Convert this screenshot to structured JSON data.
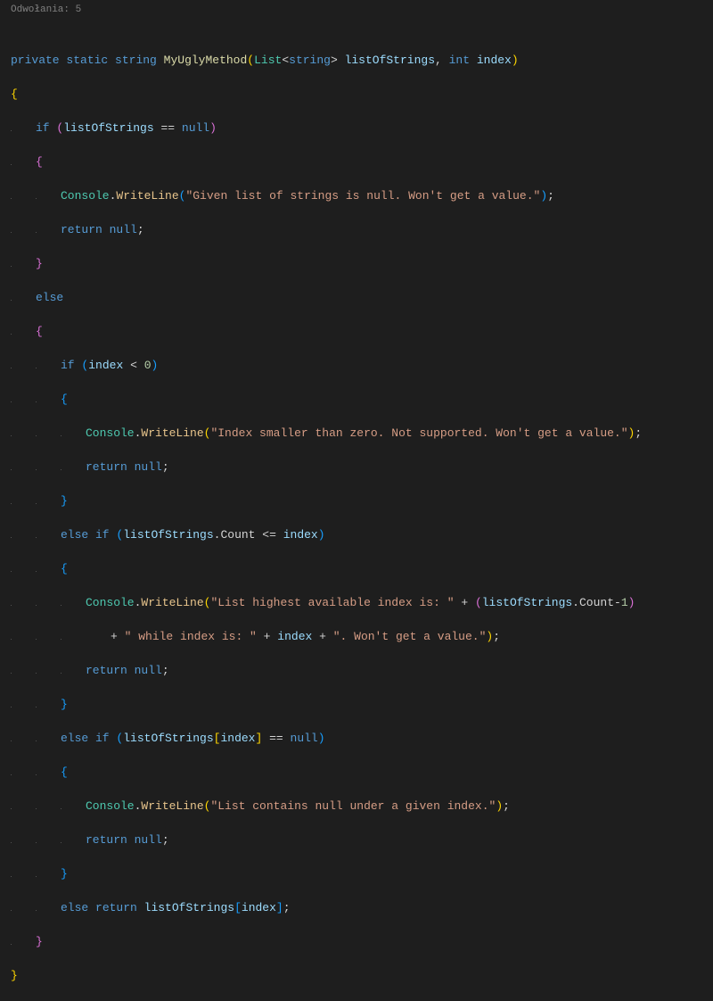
{
  "codelens": {
    "text": "Odwołania: 5"
  },
  "code": {
    "sig": {
      "kw_private": "private",
      "kw_static": "static",
      "kw_string": "string",
      "method": "MyUglyMethod",
      "type_list": "List",
      "gen_string": "string",
      "param1": "listOfStrings",
      "kw_int": "int",
      "param2": "index"
    },
    "braces": {
      "open": "{",
      "close": "}"
    },
    "kw": {
      "if": "if",
      "else": "else",
      "else_if": "else if",
      "return": "return",
      "null": "null"
    },
    "ops": {
      "eq": "==",
      "lt": "<",
      "lte": "<=",
      "plus": "+",
      "minus": "-"
    },
    "punct": {
      "lparen": "(",
      "rparen": ")",
      "lbracket": "[",
      "rbracket": "]",
      "lt": "<",
      "gt": ">",
      "comma": ",",
      "semicolon": ";",
      "dot": "."
    },
    "ident": {
      "console": "Console",
      "writeline": "WriteLine",
      "listOfStrings": "listOfStrings",
      "index": "index",
      "count": "Count"
    },
    "num": {
      "zero": "0",
      "one": "1"
    },
    "str": {
      "s1": "\"Given list of strings is null. Won't get a value.\"",
      "s2": "\"Index smaller than zero. Not supported. Won't get a value.\"",
      "s3a": "\"List highest available index is: \"",
      "s3b": "\" while index is: \"",
      "s3c": "\". Won't get a value.\"",
      "s4": "\"List contains null under a given index.\""
    }
  }
}
